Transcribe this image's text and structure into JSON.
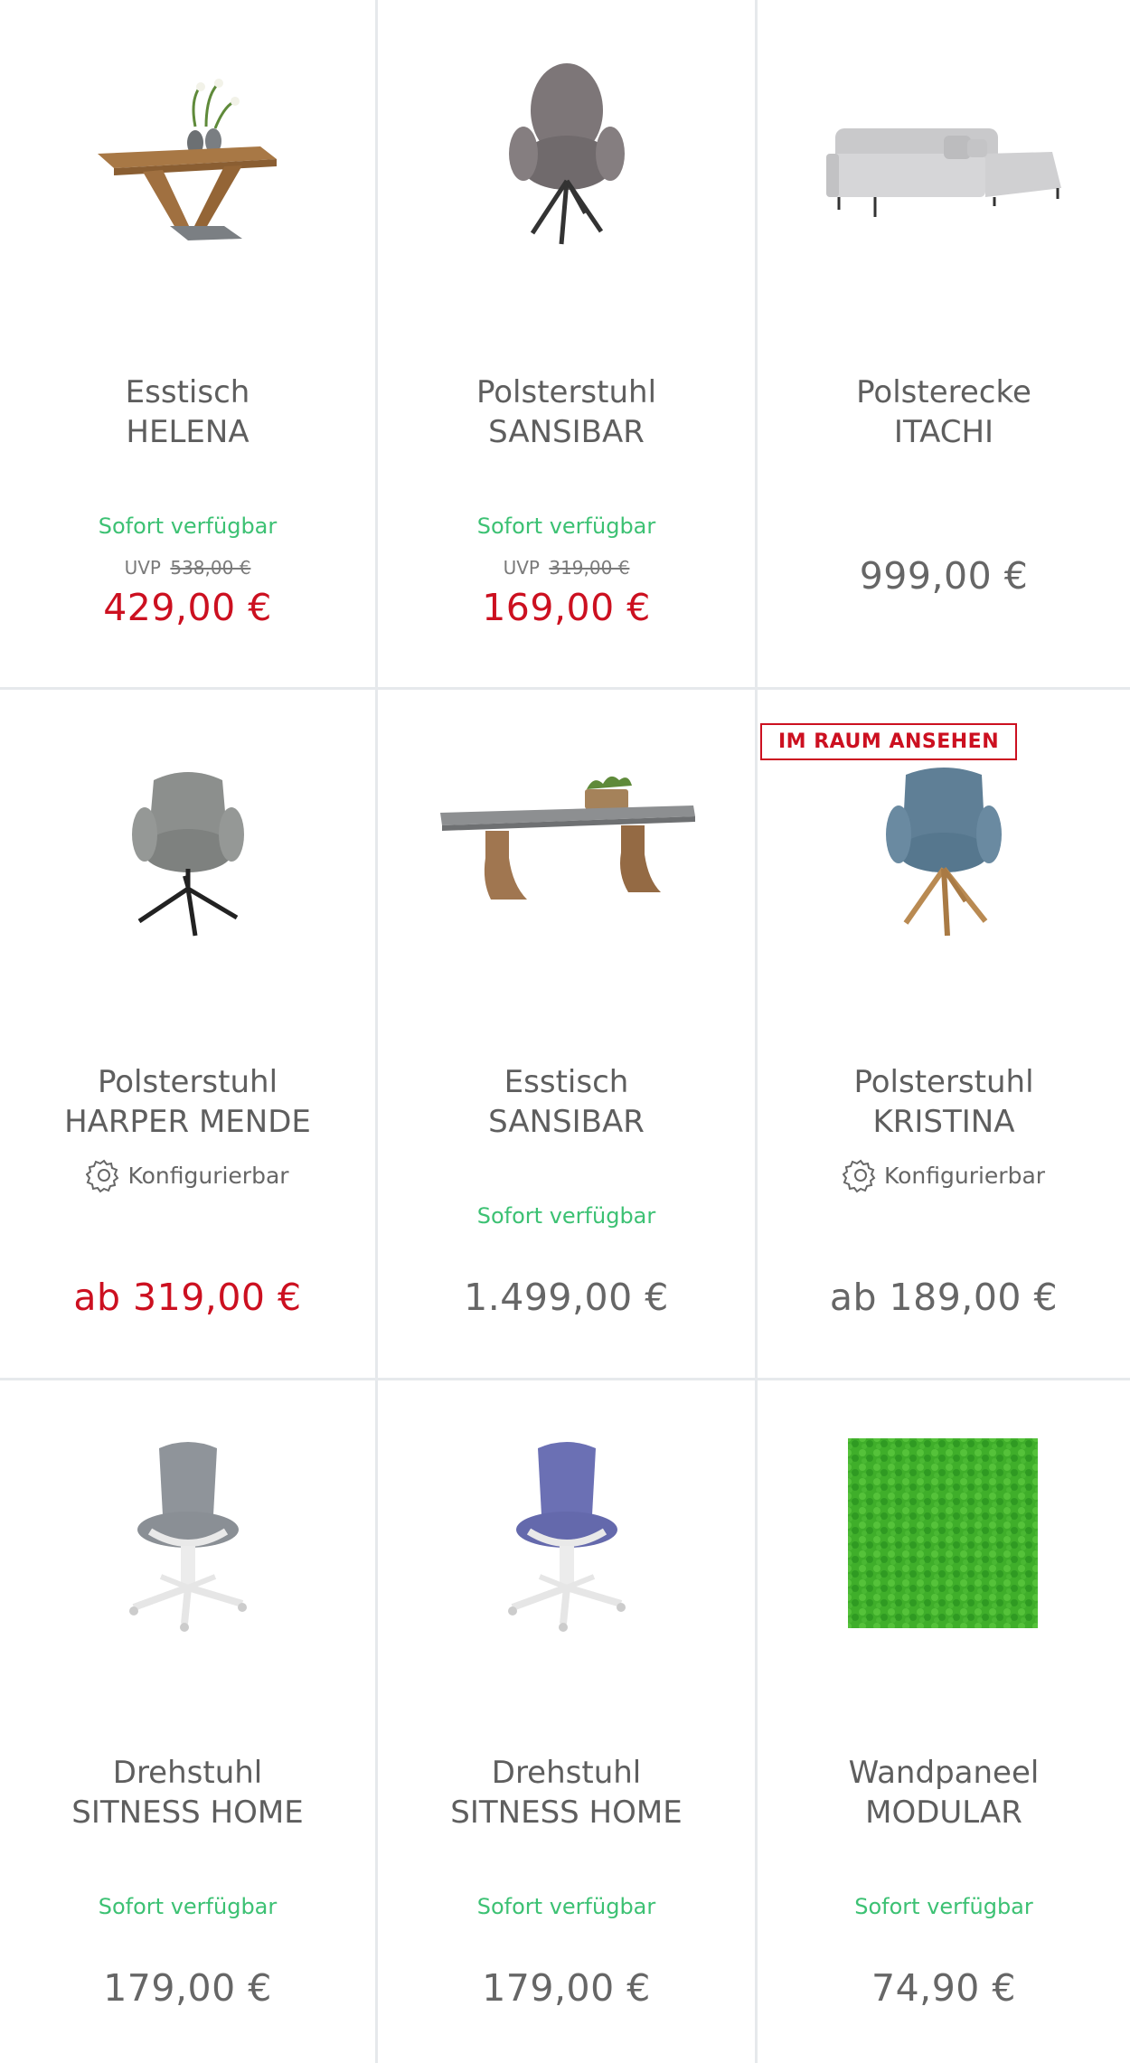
{
  "products": [
    {
      "title_line1": "Esstisch",
      "title_line2": "HELENA",
      "availability": "Sofort verfügbar",
      "uvp_label": "UVP",
      "uvp_price": "538,00 €",
      "price": "429,00 €"
    },
    {
      "title_line1": "Polsterstuhl",
      "title_line2": "SANSIBAR",
      "availability": "Sofort verfügbar",
      "uvp_label": "UVP",
      "uvp_price": "319,00 €",
      "price": "169,00 €"
    },
    {
      "title_line1": "Polsterecke",
      "title_line2": "ITACHI",
      "price": "999,00 €"
    },
    {
      "title_line1": "Polsterstuhl",
      "title_line2": "HARPER MENDE",
      "config_label": "Konfigurierbar",
      "price": "ab 319,00 €"
    },
    {
      "title_line1": "Esstisch",
      "title_line2": "SANSIBAR",
      "availability": "Sofort verfügbar",
      "price": "1.499,00 €"
    },
    {
      "badge": "IM RAUM ANSEHEN",
      "title_line1": "Polsterstuhl",
      "title_line2": "KRISTINA",
      "config_label": "Konfigurierbar",
      "price": "ab 189,00 €"
    },
    {
      "title_line1": "Drehstuhl",
      "title_line2": "SITNESS HOME",
      "availability": "Sofort verfügbar",
      "price": "179,00 €"
    },
    {
      "title_line1": "Drehstuhl",
      "title_line2": "SITNESS HOME",
      "availability": "Sofort verfügbar",
      "price": "179,00 €"
    },
    {
      "title_line1": "Wandpaneel",
      "title_line2": "MODULAR",
      "availability": "Sofort verfügbar",
      "price": "74,90 €"
    }
  ],
  "icons": {
    "config": "gear-icon"
  },
  "colors": {
    "sale_price": "#cc1020",
    "availability": "#3cc173",
    "regular_price": "#666666",
    "divider": "#e6e9ec"
  }
}
